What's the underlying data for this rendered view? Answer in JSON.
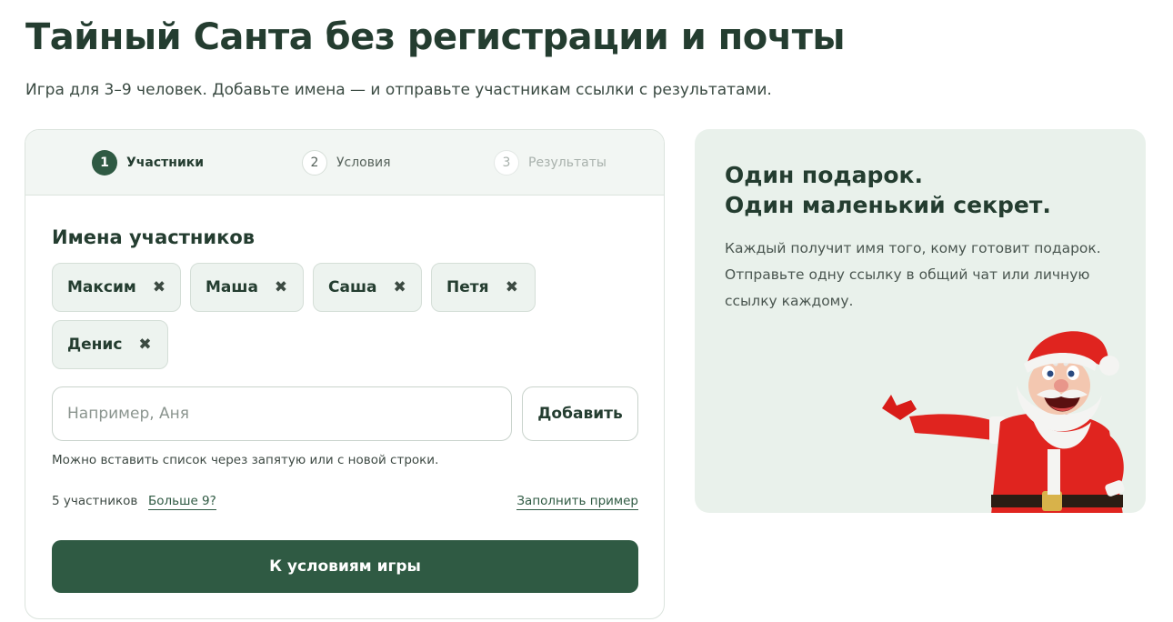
{
  "page": {
    "title": "Тайный Санта без регистрации и почты",
    "subtitle": "Игра для 3–9 человек. Добавьте имена — и отправьте участникам ссылки с результатами."
  },
  "steps": [
    {
      "num": "1",
      "label": "Участники",
      "state": "active"
    },
    {
      "num": "2",
      "label": "Условия",
      "state": "next"
    },
    {
      "num": "3",
      "label": "Результаты",
      "state": "disabled"
    }
  ],
  "participants": {
    "heading": "Имена участников",
    "names": [
      "Максим",
      "Маша",
      "Саша",
      "Петя",
      "Денис"
    ],
    "remove_glyph": "✖",
    "input_placeholder": "Например, Аня",
    "add_button": "Добавить",
    "hint": "Можно вставить список через запятую или с новой строки.",
    "count_text": "5 участников",
    "more_link": "Больше 9?",
    "fill_example_link": "Заполнить пример",
    "next_button": "К условиям игры"
  },
  "promo": {
    "heading_line1": "Один подарок.",
    "heading_line2": "Один маленький секрет.",
    "text": "Каждый получит имя того, кому готовит подарок. Отправьте одну ссылку в общий чат или личную ссылку каждому.",
    "illustration": "santa-illustration"
  },
  "colors": {
    "accent": "#2f5a43",
    "heading": "#243d30",
    "chip_bg": "#edf3ef",
    "promo_bg": "#e9f1eb",
    "santa_red": "#e0241f"
  }
}
